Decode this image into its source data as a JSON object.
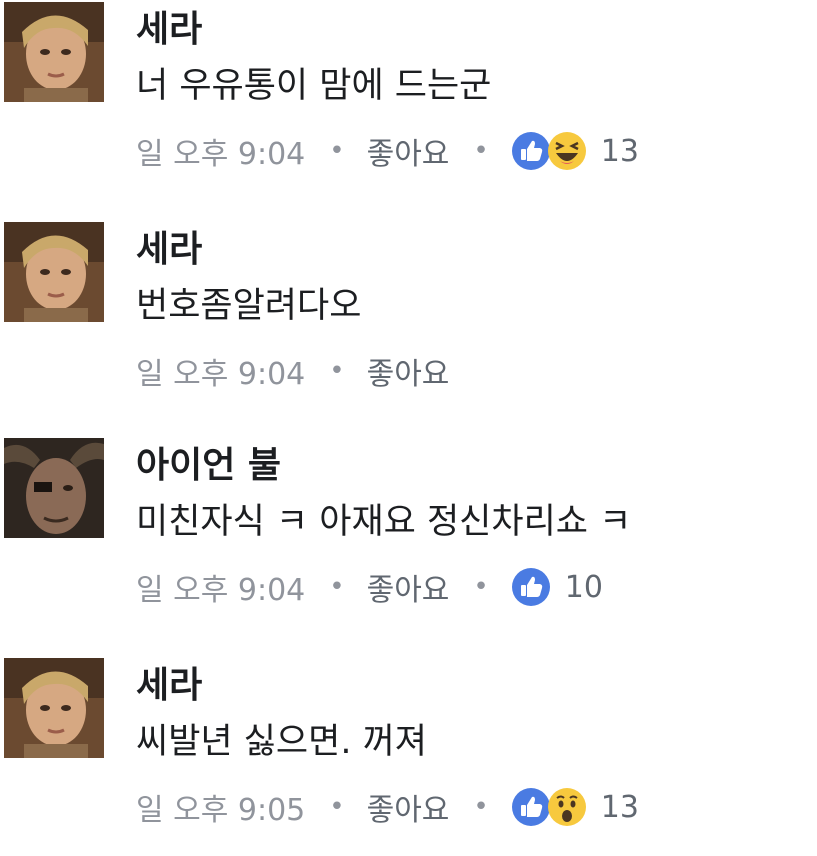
{
  "comments": [
    {
      "author": "세라",
      "text": "너 우유통이 맘에 드는군",
      "time": "일 오후 9:04",
      "like_label": "좋아요",
      "reactions": [
        "like-icon",
        "haha-icon"
      ],
      "reaction_count": "13"
    },
    {
      "author": "세라",
      "text": "번호좀알려다오",
      "time": "일 오후 9:04",
      "like_label": "좋아요",
      "reactions": [],
      "reaction_count": ""
    },
    {
      "author": "아이언 불",
      "text": "미친자식 ㅋ 아재요 정신차리쇼 ㅋ",
      "time": "일 오후 9:04",
      "like_label": "좋아요",
      "reactions": [
        "like-icon"
      ],
      "reaction_count": "10"
    },
    {
      "author": "세라",
      "text": "씨발년 싫으면. 꺼져",
      "time": "일 오후 9:05",
      "like_label": "좋아요",
      "reactions": [
        "like-icon",
        "wow-icon"
      ],
      "reaction_count": "13"
    }
  ],
  "separator": "•",
  "colors": {
    "like_blue": "#4a7be2",
    "emoji_yellow": "#f7c93e",
    "meta_gray": "#90949c",
    "text_dark": "#1c1e21"
  }
}
